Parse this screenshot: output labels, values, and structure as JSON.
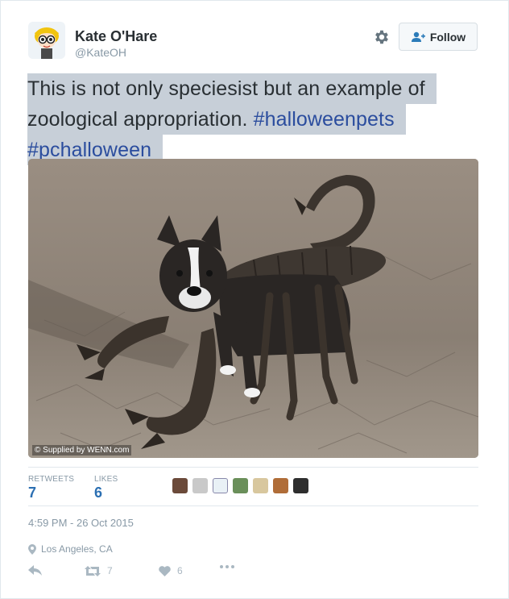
{
  "author": {
    "name": "Kate O'Hare",
    "handle": "@KateOH",
    "avatar_icon": "cartoon-avatar-icon"
  },
  "header": {
    "settings_icon": "gear-icon",
    "follow_label": "Follow"
  },
  "tweet": {
    "text_line1": "This is not only speciesist but an example of",
    "text_line2": "zoological appropriation.",
    "hashtag1": "#halloweenpets",
    "hashtag2": "#pchalloween"
  },
  "media": {
    "credit": "© Supplied by WENN.com",
    "description_icon": "dog-in-scorpion-costume-photo"
  },
  "stats": {
    "retweets_label": "RETWEETS",
    "retweets_count": "7",
    "likes_label": "LIKES",
    "likes_count": "6"
  },
  "meta": {
    "timestamp": "4:59 PM - 26 Oct 2015",
    "location": "Los Angeles, CA"
  },
  "actions": {
    "reply_icon": "reply-icon",
    "retweet_icon": "retweet-icon",
    "retweet_count": "7",
    "like_icon": "heart-icon",
    "like_count": "6",
    "more_icon": "more-dots-icon"
  },
  "colors": {
    "link": "#2b4d9e",
    "stat": "#2b6fb2",
    "muted": "#8899a6",
    "highlight": "#c7cfd8"
  }
}
